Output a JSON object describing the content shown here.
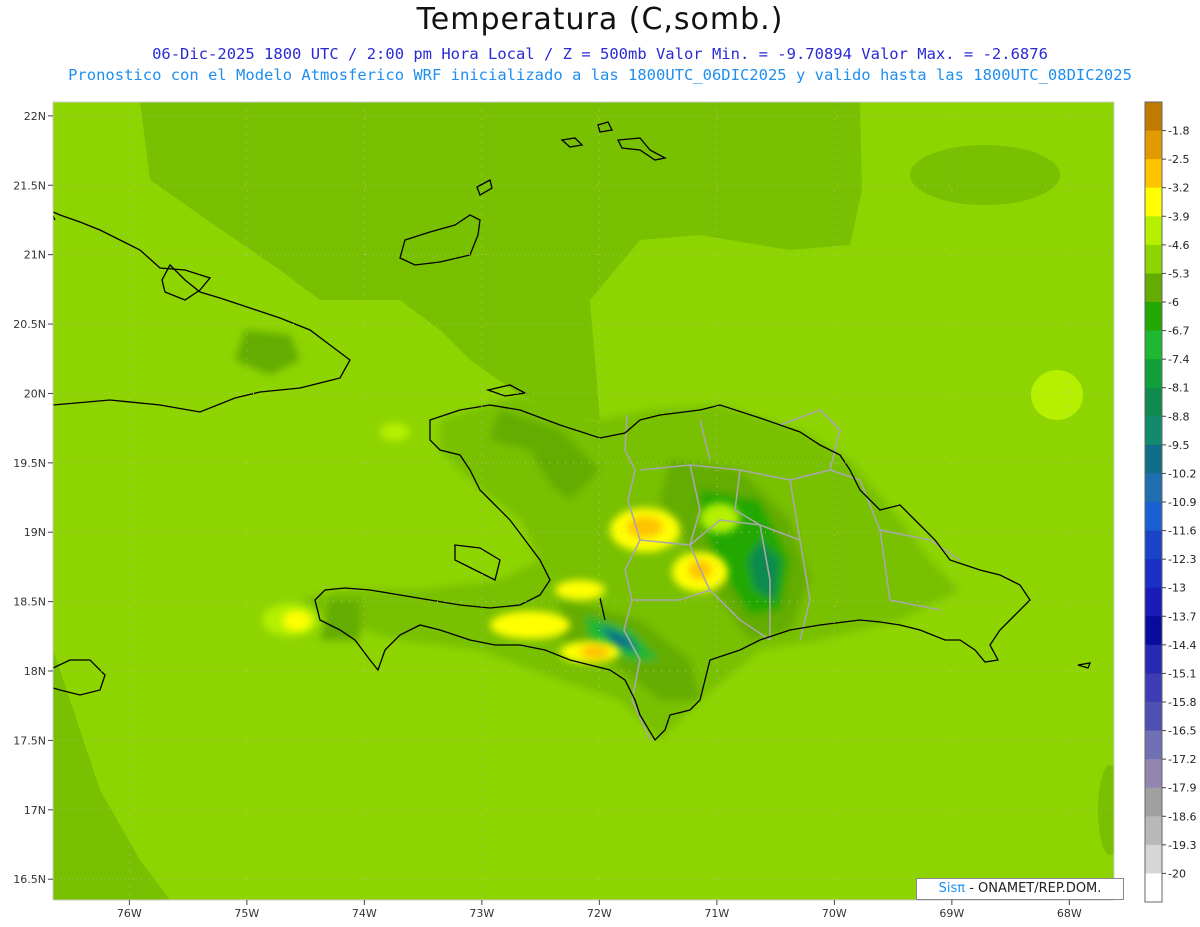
{
  "title": "Temperatura (C,somb.)",
  "subtitle_line1": "06-Dic-2025   1800 UTC / 2:00 pm Hora Local / Z = 500mb   Valor Min. = -9.70894  Valor Max. = -2.6876",
  "subtitle_line2": "Pronostico con el Modelo Atmosferico WRF inicializado a las 1800UTC_06DIC2025 y valido hasta las  1800UTC_08DIC2025",
  "credit": {
    "brand": "Sisπ",
    "text": " - ONAMET/REP.DOM."
  },
  "map": {
    "lon_range": [
      -76.65,
      -67.62
    ],
    "lat_range": [
      16.35,
      22.1
    ],
    "lat_ticks": [
      "22N",
      "21.5N",
      "21N",
      "20.5N",
      "20N",
      "19.5N",
      "19N",
      "18.5N",
      "18N",
      "17.5N",
      "17N",
      "16.5N"
    ],
    "lon_ticks": [
      "76W",
      "75W",
      "74W",
      "73W",
      "72W",
      "71W",
      "70W",
      "69W",
      "68W"
    ]
  },
  "colorbar": {
    "labels": [
      "-1.8",
      "-2.5",
      "-3.2",
      "-3.9",
      "-4.6",
      "-5.3",
      "-6",
      "-6.7",
      "-7.4",
      "-8.1",
      "-8.8",
      "-9.5",
      "-10.2",
      "-10.9",
      "-11.6",
      "-12.3",
      "-13",
      "-13.7",
      "-14.4",
      "-15.1",
      "-15.8",
      "-16.5",
      "-17.2",
      "-17.9",
      "-18.6",
      "-19.3",
      "-20"
    ],
    "colors": [
      "#c07a00",
      "#e39a00",
      "#ffc300",
      "#ffff00",
      "#b4f000",
      "#8ed400",
      "#64ac00",
      "#22a800",
      "#1fb833",
      "#11a03a",
      "#118a4e",
      "#118a6e",
      "#116e8a",
      "#1f6eb0",
      "#1a60d0",
      "#1a44c8",
      "#1a2ec8",
      "#1a1ab8",
      "#0a0a9e",
      "#2828b0",
      "#3c3cb4",
      "#5050b4",
      "#7070b4",
      "#9484b0",
      "#a0a0a0",
      "#b8b8b8",
      "#d6d6d6",
      "#ffffff"
    ]
  }
}
